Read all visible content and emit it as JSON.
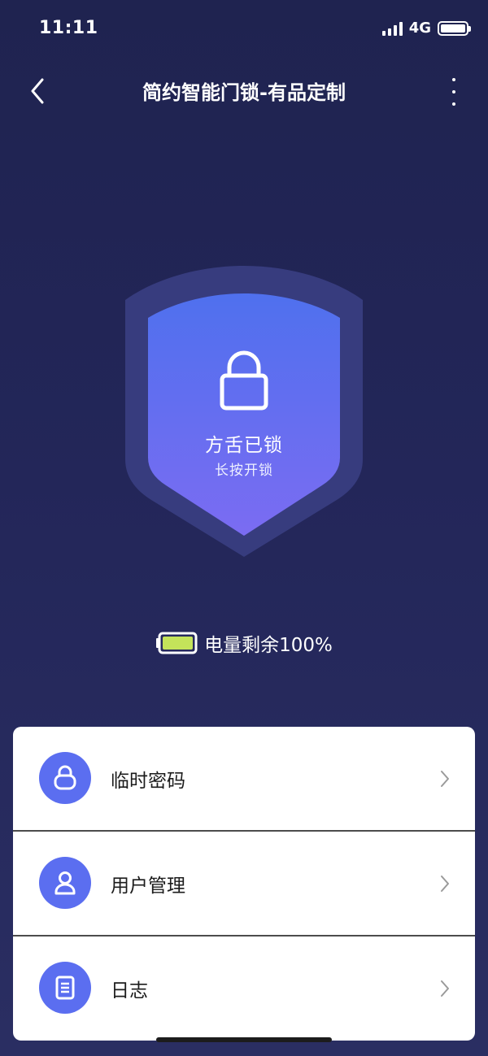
{
  "status_bar": {
    "time": "11:11",
    "network": "4G"
  },
  "nav": {
    "title": "简约智能门锁-有品定制",
    "back_icon": "chevron-left-icon",
    "more_icon": "more-vertical-icon"
  },
  "lock": {
    "status": "方舌已锁",
    "hint": "长按开锁",
    "icon": "padlock-icon",
    "colors": {
      "shield_outer": "#3a3f82",
      "shield_top": "#4f70ee",
      "shield_bottom": "#7b6cf2"
    }
  },
  "battery": {
    "label": "电量剩余100%",
    "level": 100,
    "color": "#c4e35a"
  },
  "menu": {
    "items": [
      {
        "label": "临时密码",
        "icon": "lock-icon"
      },
      {
        "label": "用户管理",
        "icon": "user-icon"
      },
      {
        "label": "日志",
        "icon": "log-document-icon"
      }
    ],
    "accent": "#5b6ef0"
  }
}
